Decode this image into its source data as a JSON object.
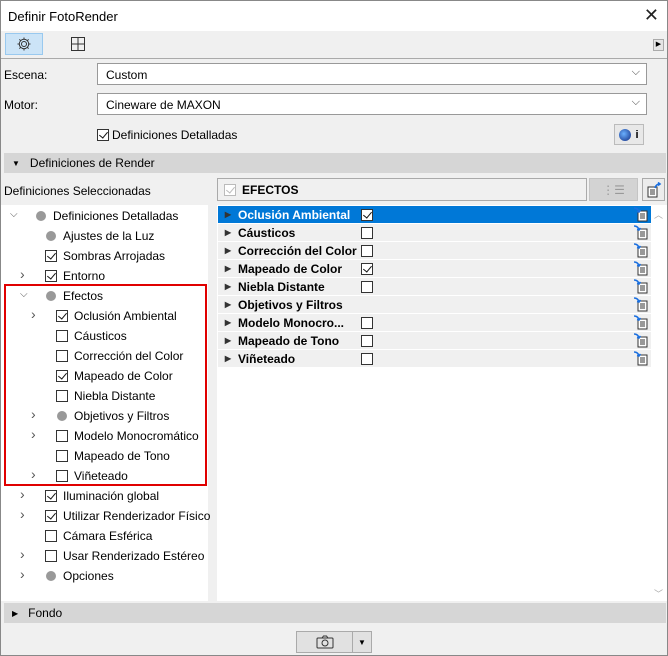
{
  "window": {
    "title": "Definir FotoRender"
  },
  "toolbar": {
    "tabs": [
      {
        "icon": "gear-icon",
        "selected": true
      },
      {
        "icon": "layout-icon",
        "selected": false
      }
    ]
  },
  "form": {
    "scene_label": "Escena:",
    "scene_value": "Custom",
    "engine_label": "Motor:",
    "engine_value": "Cineware de MAXON",
    "detailed_label": "Definiciones Detalladas",
    "detailed_checked": true,
    "info_label": "i"
  },
  "sections": {
    "render": "Definiciones de Render",
    "background": "Fondo"
  },
  "tree": {
    "header": "Definiciones Seleccionadas",
    "items": [
      {
        "label": "Definiciones Detalladas",
        "level": 0,
        "expanded": true,
        "type": "dot"
      },
      {
        "label": "Ajustes de la Luz",
        "level": 1,
        "type": "dot"
      },
      {
        "label": "Sombras Arrojadas",
        "level": 1,
        "type": "check",
        "checked": true
      },
      {
        "label": "Entorno",
        "level": 1,
        "type": "check",
        "checked": true,
        "collapsed": true
      },
      {
        "label": "Efectos",
        "level": 1,
        "type": "dot",
        "expanded": true
      },
      {
        "label": "Oclusión Ambiental",
        "level": 2,
        "type": "check",
        "checked": true,
        "collapsed": true
      },
      {
        "label": "Cáusticos",
        "level": 2,
        "type": "check",
        "checked": false
      },
      {
        "label": "Corrección del Color",
        "level": 2,
        "type": "check",
        "checked": false
      },
      {
        "label": "Mapeado de Color",
        "level": 2,
        "type": "check",
        "checked": true
      },
      {
        "label": "Niebla Distante",
        "level": 2,
        "type": "check",
        "checked": false
      },
      {
        "label": "Objetivos y Filtros",
        "level": 2,
        "type": "dot",
        "collapsed": true
      },
      {
        "label": "Modelo Monocromático",
        "level": 2,
        "type": "check",
        "checked": false,
        "collapsed": true
      },
      {
        "label": "Mapeado de Tono",
        "level": 2,
        "type": "check",
        "checked": false
      },
      {
        "label": "Viñeteado",
        "level": 2,
        "type": "check",
        "checked": false,
        "collapsed": true
      },
      {
        "label": "Iluminación global",
        "level": 1,
        "type": "check",
        "checked": true,
        "collapsed": true
      },
      {
        "label": "Utilizar Renderizador Físico",
        "level": 1,
        "type": "check",
        "checked": true,
        "collapsed": true
      },
      {
        "label": "Cámara Esférica",
        "level": 1,
        "type": "check",
        "checked": false
      },
      {
        "label": "Usar Renderizado Estéreo",
        "level": 1,
        "type": "check",
        "checked": false,
        "collapsed": true
      },
      {
        "label": "Opciones",
        "level": 1,
        "type": "dot",
        "collapsed": true
      }
    ]
  },
  "effects": {
    "header": "EFECTOS",
    "header_checked": true,
    "rows": [
      {
        "label": "Oclusión Ambiental",
        "checked": true,
        "selected": true
      },
      {
        "label": "Cáusticos",
        "checked": false
      },
      {
        "label": "Corrección del Color",
        "checked": false
      },
      {
        "label": "Mapeado de Color",
        "checked": true
      },
      {
        "label": "Niebla Distante",
        "checked": false
      },
      {
        "label": "Objetivos y Filtros",
        "checked": null
      },
      {
        "label": "Modelo Monocro...",
        "checked": false
      },
      {
        "label": "Mapeado de Tono",
        "checked": false
      },
      {
        "label": "Viñeteado",
        "checked": false
      }
    ]
  },
  "colors": {
    "selection": "#0078d7",
    "highlight_border": "#e00000"
  }
}
